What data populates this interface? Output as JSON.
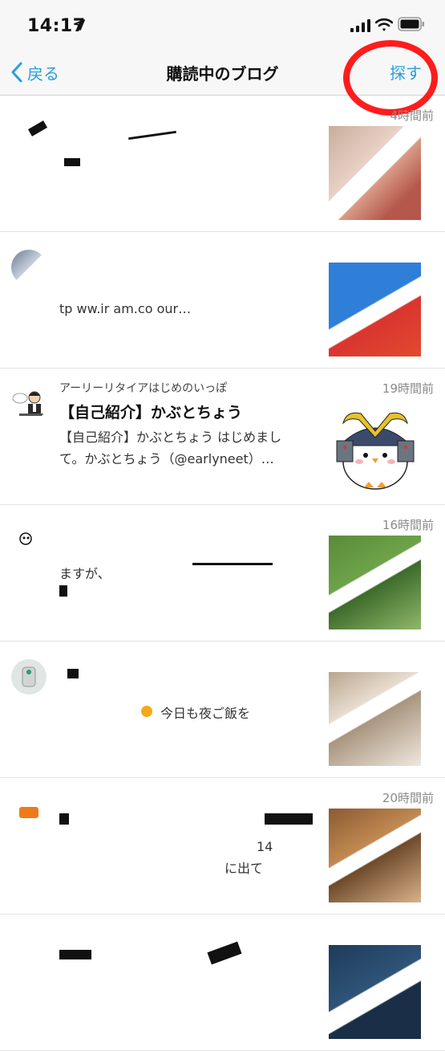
{
  "status": {
    "time": "14:17"
  },
  "nav": {
    "back_label": "戻る",
    "title": "購読中のブログ",
    "find_label": "探す"
  },
  "posts": [
    {
      "blog": "",
      "time": "4時間前",
      "title": "",
      "excerpt_lines": [
        "",
        ""
      ]
    },
    {
      "blog": "",
      "time": "",
      "title": "",
      "excerpt_lines": [
        "",
        "tp   ww.ir   am.co   our…"
      ]
    },
    {
      "blog": "アーリーリタイアはじめのいっぽ",
      "time": "19時間前",
      "title": "【自己紹介】かぶとちょう",
      "excerpt_lines": [
        "【自己紹介】かぶとちょう はじめまし",
        "て。かぶとちょう（@earlyneet）…"
      ]
    },
    {
      "blog": "",
      "time": "16時間前",
      "title": "",
      "excerpt_lines": [
        "",
        "    ますが、"
      ]
    },
    {
      "blog": "",
      "time": "",
      "title": "",
      "excerpt_lines": [
        "今日も夜ご飯を",
        ""
      ]
    },
    {
      "blog": "",
      "time": "20時間前",
      "title": "",
      "excerpt_lines": [
        "14",
        "に出て"
      ]
    },
    {
      "blog": "",
      "time": "",
      "title": "",
      "excerpt_lines": [
        "",
        ""
      ]
    }
  ]
}
